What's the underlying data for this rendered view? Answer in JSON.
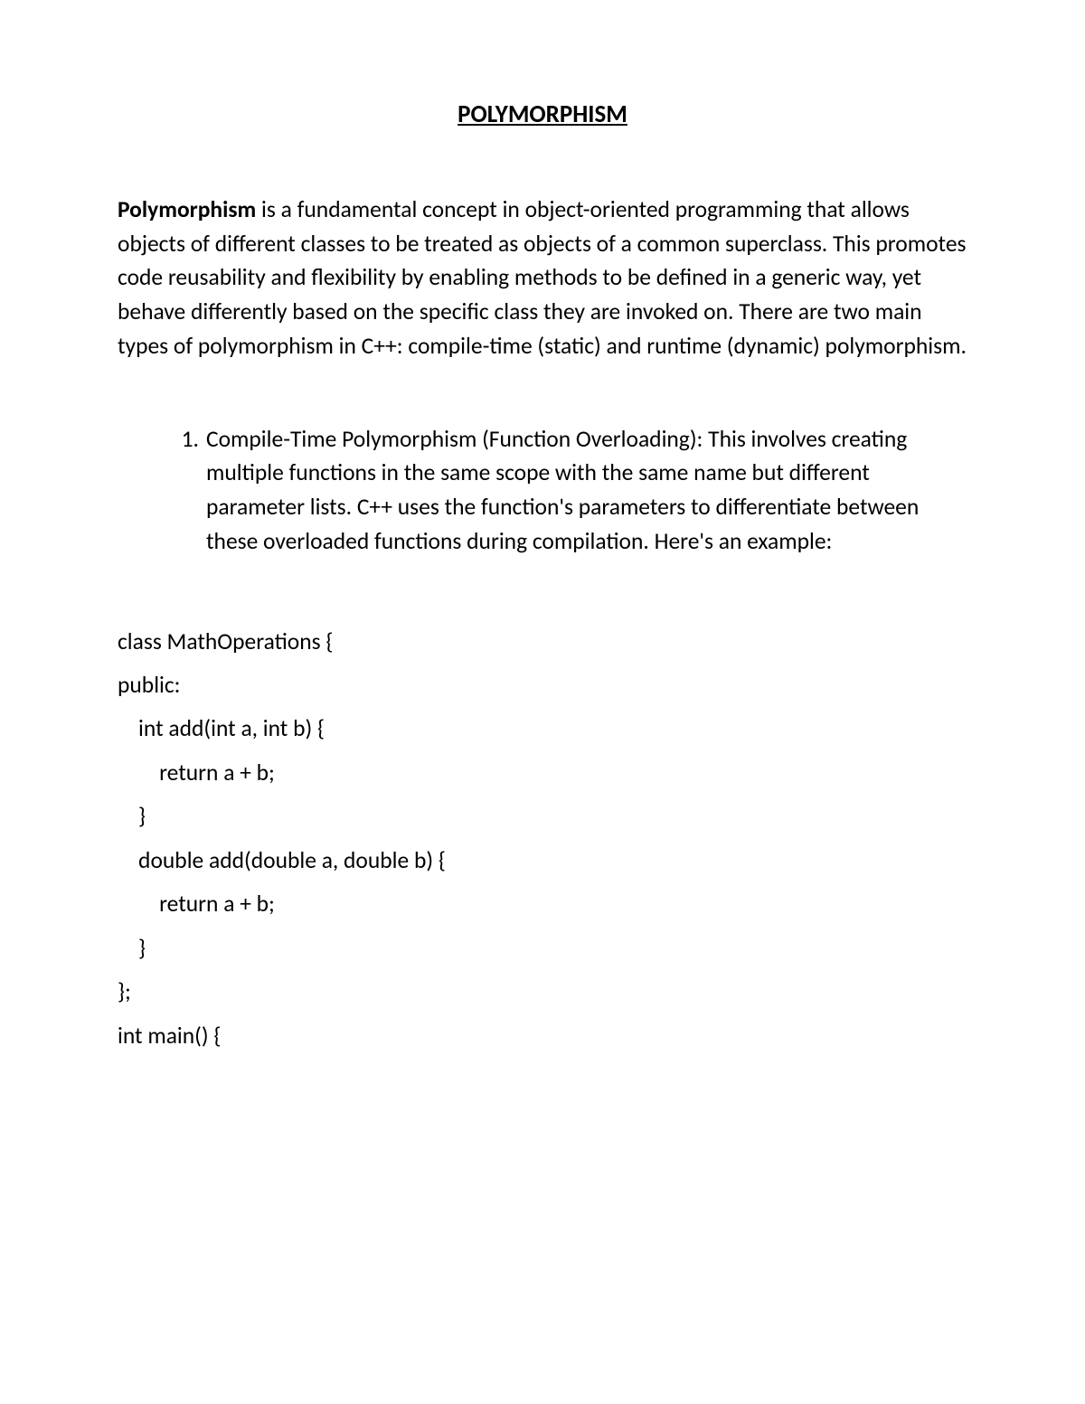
{
  "title": "POLYMORPHISM",
  "intro": {
    "bold": "Polymorphism",
    "rest": " is a fundamental concept in object-oriented programming that allows objects of different classes to be treated as objects of a common superclass. This promotes code reusability and flexibility by enabling methods to be defined in a generic way, yet behave differently based on the specific class they are invoked on. There are two main types of polymorphism in C++: compile-time (static) and runtime (dynamic) polymorphism."
  },
  "listItem": {
    "number": "1.",
    "boldPart": "Compile-Time Polymorphism (Function Overloading):",
    "rest": " This involves creating multiple functions in the same scope with the same name but different parameter lists. C++ uses the function's parameters to differentiate between these overloaded functions during compilation. Here's an example:"
  },
  "code": {
    "line1": "class MathOperations {",
    "line2": "public:",
    "line3": "    int add(int a, int b) {",
    "line4": "        return a + b;",
    "line5": "    }",
    "line6": "",
    "line7": "    double add(double a, double b) {",
    "line8": "        return a + b;",
    "line9": "    }",
    "line10": "};",
    "line11": "",
    "line12": "int main() {"
  }
}
